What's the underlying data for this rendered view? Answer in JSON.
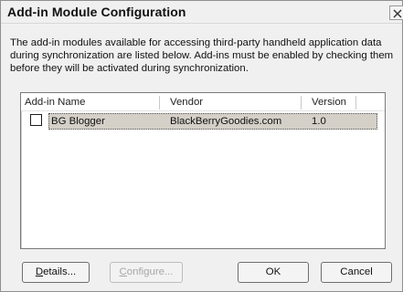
{
  "window": {
    "title": "Add-in Module Configuration",
    "close_icon": "close-x-icon"
  },
  "description": "The add-in modules available for accessing third-party handheld application data during synchronization are listed below. Add-ins must be enabled by checking them before they will be activated during synchronization.",
  "list": {
    "columns": [
      "Add-in Name",
      "Vendor",
      "Version"
    ],
    "rows": [
      {
        "checked": false,
        "name": "BG Blogger",
        "vendor": "BlackBerryGoodies.com",
        "version": "1.0"
      }
    ]
  },
  "buttons": {
    "details": {
      "mnemonic": "D",
      "rest": "etails..."
    },
    "configure": {
      "mnemonic": "C",
      "rest": "onfigure...",
      "enabled": false
    },
    "ok": "OK",
    "cancel": "Cancel"
  },
  "colors": {
    "selection_bg": "#d4d0c8",
    "disabled_text": "#a7a7a7"
  }
}
